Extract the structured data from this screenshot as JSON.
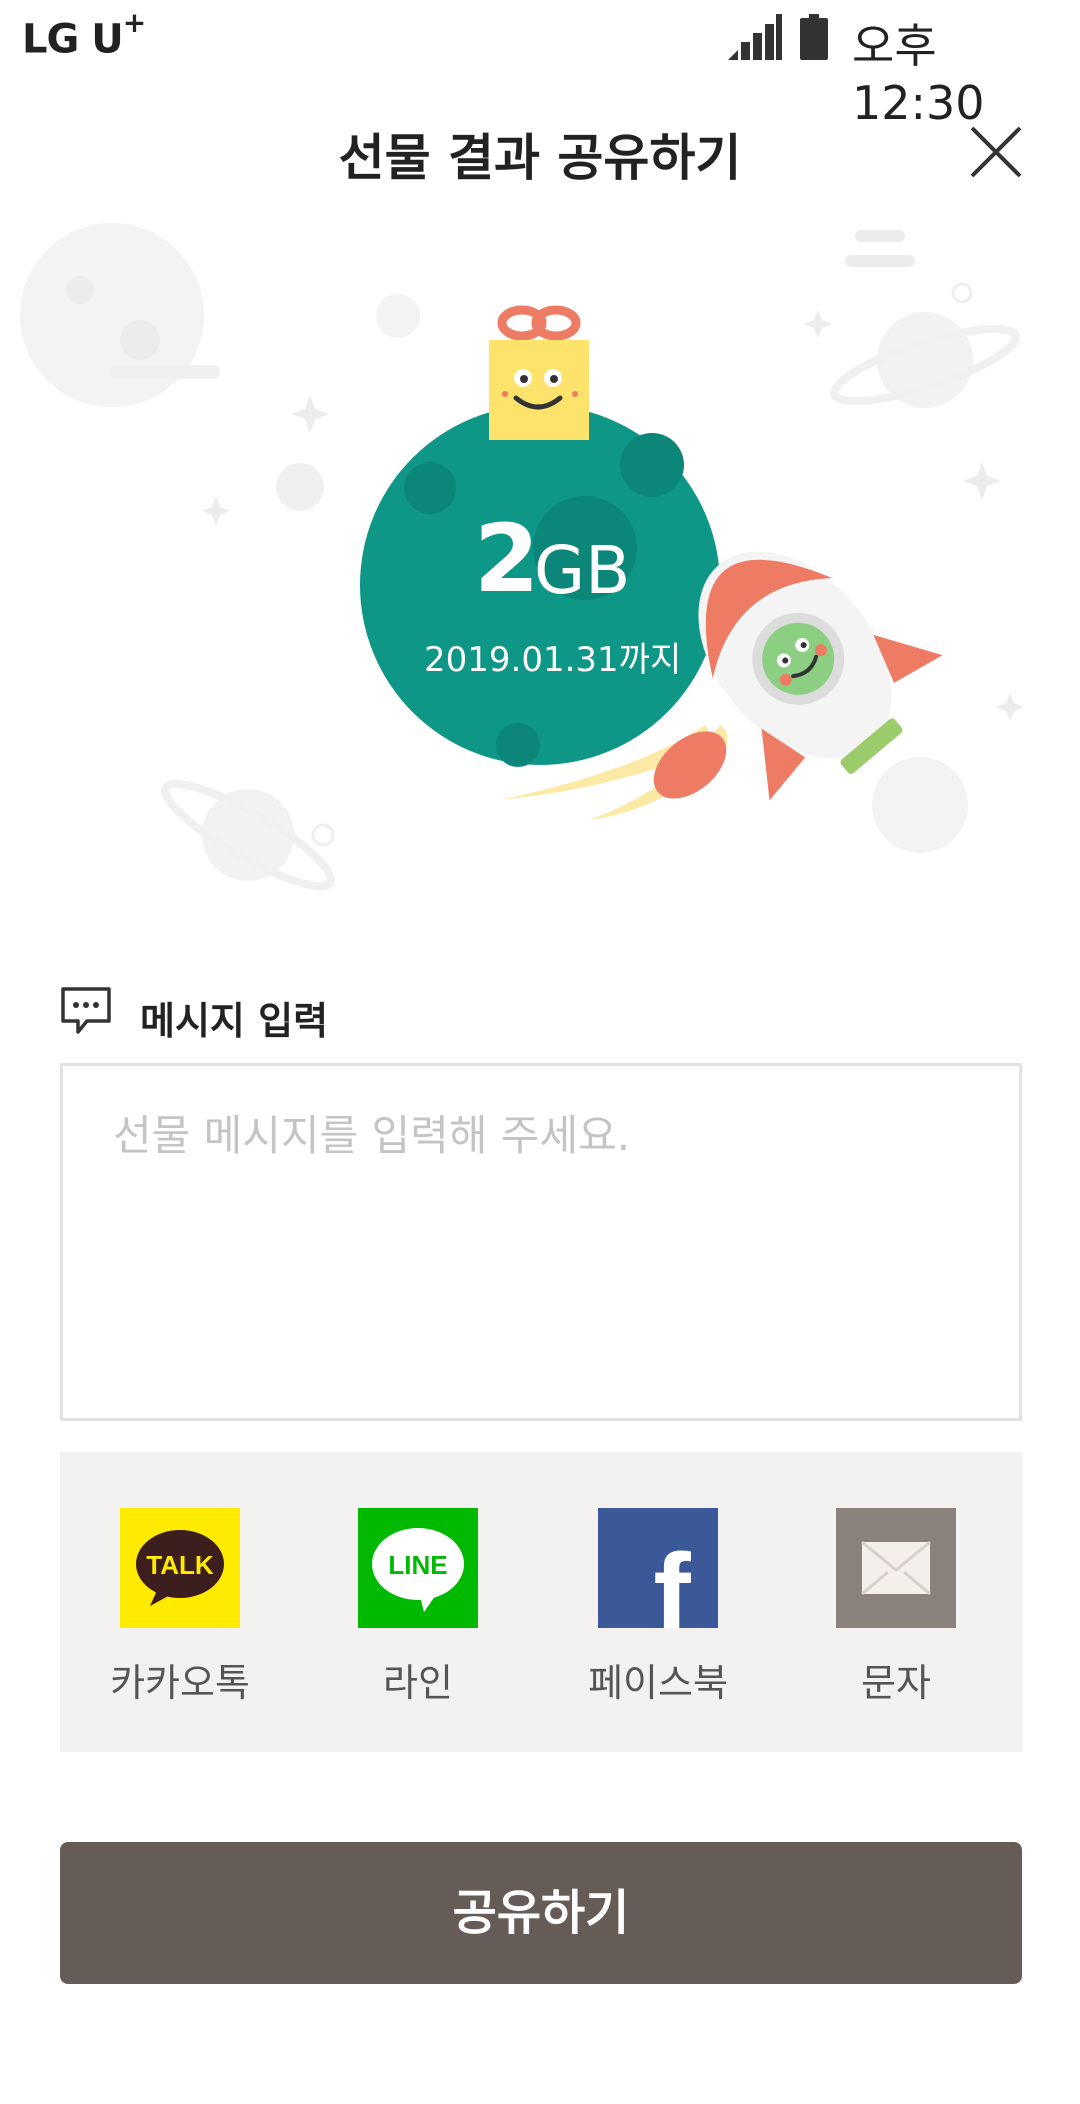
{
  "status_bar": {
    "carrier": "LG U",
    "carrier_plus": "+",
    "time": "오후 12:30",
    "signal_icon": "cell-signal-icon",
    "battery_icon": "battery-icon"
  },
  "header": {
    "title": "선물 결과 공유하기",
    "close_icon": "close-icon"
  },
  "gift": {
    "amount": "2",
    "unit": "GB",
    "expiry": "2019.01.31까지",
    "globe_color": "#0e9687"
  },
  "message": {
    "label": "메시지 입력",
    "placeholder": "선물 메시지를 입력해 주세요.",
    "value": ""
  },
  "share_targets": [
    {
      "label": "카카오톡",
      "icon": "kakaotalk-icon",
      "icon_text": "TALK",
      "color": "#ffeb00"
    },
    {
      "label": "라인",
      "icon": "line-icon",
      "icon_text": "LINE",
      "color": "#00b900"
    },
    {
      "label": "페이스북",
      "icon": "facebook-icon",
      "icon_text": "f",
      "color": "#3b5998"
    },
    {
      "label": "문자",
      "icon": "sms-envelope-icon",
      "icon_text": "",
      "color": "#8a807c"
    }
  ],
  "share_button": {
    "label": "공유하기",
    "color": "#665c57"
  }
}
